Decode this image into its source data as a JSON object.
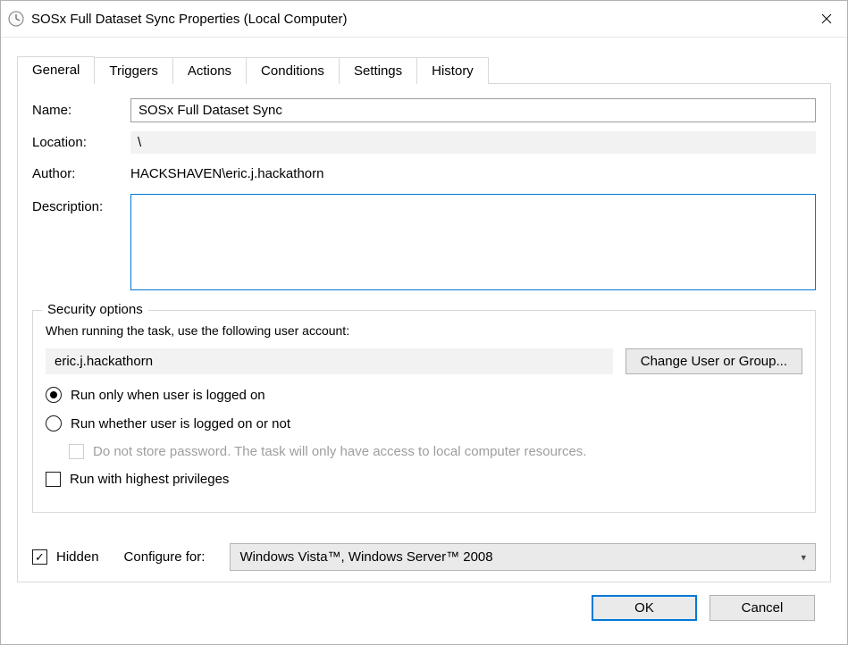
{
  "window": {
    "title": "SOSx Full Dataset Sync Properties (Local Computer)"
  },
  "tabs": [
    {
      "label": "General"
    },
    {
      "label": "Triggers"
    },
    {
      "label": "Actions"
    },
    {
      "label": "Conditions"
    },
    {
      "label": "Settings"
    },
    {
      "label": "History"
    }
  ],
  "general": {
    "name_label": "Name:",
    "name_value": "SOSx Full Dataset Sync",
    "location_label": "Location:",
    "location_value": "\\",
    "author_label": "Author:",
    "author_value": "HACKSHAVEN\\eric.j.hackathorn",
    "description_label": "Description:",
    "description_value": ""
  },
  "security": {
    "legend": "Security options",
    "prompt": "When running the task, use the following user account:",
    "user": "eric.j.hackathorn",
    "change_button": "Change User or Group...",
    "radio_logged_on": "Run only when user is logged on",
    "radio_logged_on_or_not": "Run whether user is logged on or not",
    "no_store_password": "Do not store password.  The task will only have access to local computer resources.",
    "highest_privileges": "Run with highest privileges"
  },
  "bottom": {
    "hidden_label": "Hidden",
    "configure_for_label": "Configure for:",
    "configure_for_value": "Windows Vista™, Windows Server™ 2008"
  },
  "buttons": {
    "ok": "OK",
    "cancel": "Cancel"
  }
}
